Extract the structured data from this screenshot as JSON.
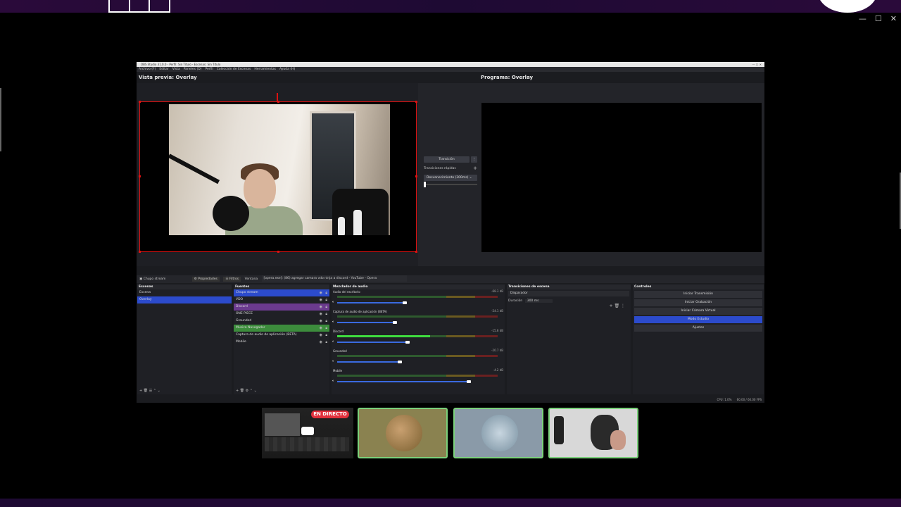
{
  "obs": {
    "title": "OBS Studio 31.0.0 - Perfil: Sin Título - Escenas: Sin Título",
    "menu": [
      "Archivo (F)",
      "Editar",
      "Vista",
      "Paneles (D)",
      "Perfil",
      "Colección de Escenas",
      "Herramientas",
      "Ayuda (H)"
    ],
    "preview_label": "Vista previa: Overlay",
    "program_label": "Programa: Overlay",
    "transition_button": "Transición",
    "quick_transitions": "Transiciones rápidas",
    "transition_select": "Desvanecimiento (300ms)",
    "context_source": "Chupo stream",
    "context_props": "Propiedades",
    "context_filters": "Filtros",
    "context_window_label": "Ventana",
    "context_window_value": "[opera.exe]: (86) agregar camara vdo ninja a discord - YouTube - Opera"
  },
  "scenes": {
    "title": "Escenas",
    "items": [
      "Escena",
      "Overlay"
    ]
  },
  "sources": {
    "title": "Fuentes",
    "items": [
      "Chupo stream",
      "VDO",
      "Discord",
      "ONE PIECE",
      "Grounded",
      "Musica Navegador",
      "Captura de audio de aplicación (BETA)",
      "Mobile"
    ]
  },
  "mixer": {
    "title": "Mezclador de audio",
    "tracks": [
      {
        "name": "Audio del escritorio",
        "db": "-68.3 dB",
        "level": 0,
        "volume": 0.42
      },
      {
        "name": "Captura de audio de aplicación (BETA)",
        "db": "-24.1 dB",
        "level": 0,
        "volume": 0.36
      },
      {
        "name": "Discord",
        "db": "-15.6 dB",
        "level": 0.58,
        "volume": 0.44
      },
      {
        "name": "Grounded",
        "db": "-20.7 dB",
        "level": 0,
        "volume": 0.39
      },
      {
        "name": "Mobile",
        "db": "-4.2 dB",
        "level": 0,
        "volume": 0.82
      }
    ]
  },
  "scene_transitions": {
    "title": "Transiciones de escena",
    "type": "Disparador",
    "duration_label": "Duración",
    "duration_value": "300 ms"
  },
  "controls": {
    "title": "Controles",
    "buttons": [
      "Iniciar Transmisión",
      "Iniciar Grabación",
      "Iniciar Cámara Virtual",
      "Modo Estudio",
      "Ajustes"
    ]
  },
  "status": {
    "cpu": "CPU: 1.0%",
    "fps": "60.00 / 60.00 FPS"
  },
  "live_badge": "EN DIRECTO"
}
